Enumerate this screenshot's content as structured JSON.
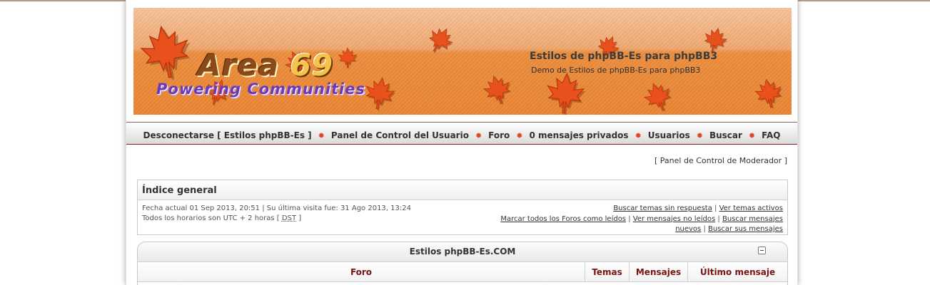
{
  "header": {
    "logo_main": "Area",
    "logo_number": "69",
    "logo_tagline": "Powering Communities",
    "site_title": "Estilos de phpBB-Es para phpBB3",
    "site_description": "Demo de Estilos de phpBB-Es para phpBB3"
  },
  "nav": {
    "items": [
      {
        "label": "Desconectarse [ Estilos phpBB-Es ]"
      },
      {
        "label": "Panel de Control del Usuario"
      },
      {
        "label": "Foro"
      },
      {
        "label": "0 mensajes privados"
      },
      {
        "label": "Usuarios"
      },
      {
        "label": "Buscar"
      },
      {
        "label": "FAQ"
      }
    ],
    "separator_icon": "maple-leaf-icon"
  },
  "moderator_panel": {
    "label": "Panel de Control de Moderador"
  },
  "index": {
    "title": "Índice general",
    "current_date": "Fecha actual 01 Sep 2013, 20:51 | Su última visita fue: 31 Ago 2013, 13:24",
    "timezone_prefix": "Todos los horarios son UTC + 2 horas [",
    "timezone_dst": "DST",
    "timezone_suffix": "]",
    "links": {
      "unanswered": "Buscar temas sin respuesta",
      "active": "Ver temas activos",
      "mark_read": "Marcar todos los Foros como leídos",
      "unread": "Ver mensajes no leídos",
      "new_posts_a": "Buscar mensajes",
      "new_posts_b": "nuevos",
      "own_posts": "Buscar sus mensajes"
    }
  },
  "category": {
    "title": "Estilos phpBB-Es.COM",
    "columns": {
      "forum": "Foro",
      "topics": "Temas",
      "posts": "Mensajes",
      "last_post": "Último mensaje"
    }
  },
  "colors": {
    "banner_orange": "#ea8532",
    "nav_separator": "#d9481c",
    "column_header": "#7a1414"
  }
}
